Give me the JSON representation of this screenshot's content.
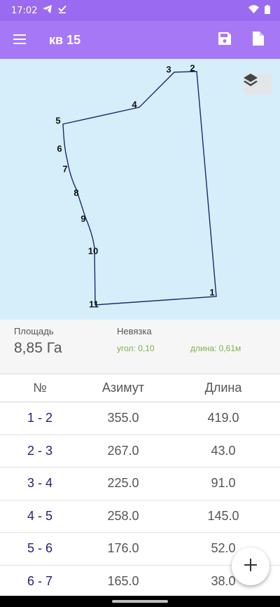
{
  "status": {
    "time": "17:02",
    "left_icons": [
      "telegram-icon",
      "download-done-icon"
    ],
    "right_icons": [
      "wifi-icon",
      "battery-icon"
    ]
  },
  "app_bar": {
    "title": "кв 15",
    "color": "#a678f5",
    "actions": [
      "save-icon",
      "document-icon"
    ]
  },
  "map": {
    "background": "#d5eef9",
    "points": [
      {
        "label": "1"
      },
      {
        "label": "2"
      },
      {
        "label": "3"
      },
      {
        "label": "4"
      },
      {
        "label": "5"
      },
      {
        "label": "6"
      },
      {
        "label": "7"
      },
      {
        "label": "8"
      },
      {
        "label": "9"
      },
      {
        "label": "10"
      },
      {
        "label": "11"
      }
    ]
  },
  "summary": {
    "area_label": "Площадь",
    "area_value": "8,85 Га",
    "closure_label": "Невязка",
    "closure_angle": "угол: 0,10",
    "closure_length": "длина: 0,61м",
    "closure_color": "#7cb342"
  },
  "table": {
    "headers": [
      "№",
      "Азимут",
      "Длина"
    ],
    "rows": [
      {
        "segment": "1 - 2",
        "azimuth": "355.0",
        "length": "419.0"
      },
      {
        "segment": "2 - 3",
        "azimuth": "267.0",
        "length": "43.0"
      },
      {
        "segment": "3 - 4",
        "azimuth": "225.0",
        "length": "91.0"
      },
      {
        "segment": "4 - 5",
        "azimuth": "258.0",
        "length": "145.0"
      },
      {
        "segment": "5 - 6",
        "azimuth": "176.0",
        "length": "52.0"
      },
      {
        "segment": "6 - 7",
        "azimuth": "165.0",
        "length": "38.0"
      }
    ]
  },
  "fab": {
    "icon": "add-icon"
  }
}
